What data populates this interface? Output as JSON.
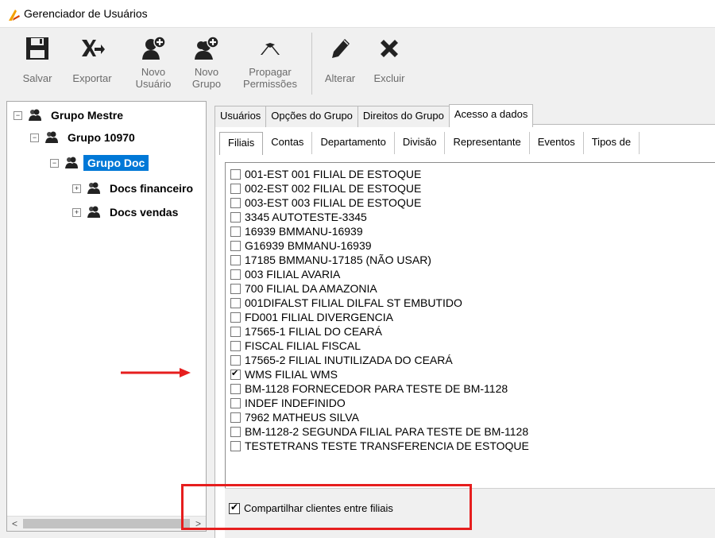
{
  "window": {
    "title": "Gerenciador de Usuários"
  },
  "toolbar": {
    "save_label": "Salvar",
    "export_label": "Exportar",
    "new_user_label": "Novo\nUsuário",
    "new_group_label": "Novo\nGrupo",
    "propagate_label": "Propagar\nPermissões",
    "edit_label": "Alterar",
    "delete_label": "Excluir"
  },
  "tree": {
    "items": [
      {
        "label": "Grupo Mestre",
        "expander": "−"
      },
      {
        "label": "Grupo 10970",
        "expander": "−"
      },
      {
        "label": "Grupo Doc",
        "expander": "−",
        "selected": true
      },
      {
        "label": "Docs financeiro",
        "expander": "+"
      },
      {
        "label": "Docs vendas",
        "expander": "+"
      }
    ],
    "scroll_left": "<",
    "scroll_right": ">"
  },
  "tabs": [
    "Usuários",
    "Opções do Grupo",
    "Direitos do Grupo",
    "Acesso a dados"
  ],
  "subtabs": [
    "Filiais",
    "Contas",
    "Departamento",
    "Divisão",
    "Representante",
    "Eventos",
    "Tipos de"
  ],
  "branches": [
    {
      "label": "001-EST 001 FILIAL DE ESTOQUE",
      "checked": false
    },
    {
      "label": "002-EST 002 FILIAL DE ESTOQUE",
      "checked": false
    },
    {
      "label": "003-EST 003 FILIAL DE ESTOQUE",
      "checked": false
    },
    {
      "label": "3345 AUTOTESTE-3345",
      "checked": false
    },
    {
      "label": "16939 BMMANU-16939",
      "checked": false
    },
    {
      "label": "G16939 BMMANU-16939",
      "checked": false
    },
    {
      "label": "17185 BMMANU-17185 (NÃO USAR)",
      "checked": false
    },
    {
      "label": "003 FILIAL AVARIA",
      "checked": false
    },
    {
      "label": "700 FILIAL DA AMAZONIA",
      "checked": false
    },
    {
      "label": "001DIFALST FILIAL DILFAL ST EMBUTIDO",
      "checked": false
    },
    {
      "label": "FD001 FILIAL DIVERGENCIA",
      "checked": false
    },
    {
      "label": "17565-1 FILIAL DO CEARÁ",
      "checked": false
    },
    {
      "label": "FISCAL FILIAL FISCAL",
      "checked": false
    },
    {
      "label": "17565-2 FILIAL INUTILIZADA DO CEARÁ",
      "checked": false
    },
    {
      "label": "WMS FILIAL WMS",
      "checked": true
    },
    {
      "label": "BM-1128 FORNECEDOR PARA TESTE DE BM-1128",
      "checked": false
    },
    {
      "label": "INDEF INDEFINIDO",
      "checked": false
    },
    {
      "label": "7962 MATHEUS SILVA",
      "checked": false
    },
    {
      "label": "BM-1128-2 SEGUNDA FILIAL PARA TESTE DE BM-1128",
      "checked": false
    },
    {
      "label": "TESTETRANS TESTE TRANSFERENCIA DE ESTOQUE",
      "checked": false
    }
  ],
  "share_clients": {
    "label": "Compartilhar clientes entre filiais",
    "checked": true
  },
  "colors": {
    "highlight": "#e61e1e",
    "selection": "#0078d7",
    "app_icon": "#f5a000"
  }
}
